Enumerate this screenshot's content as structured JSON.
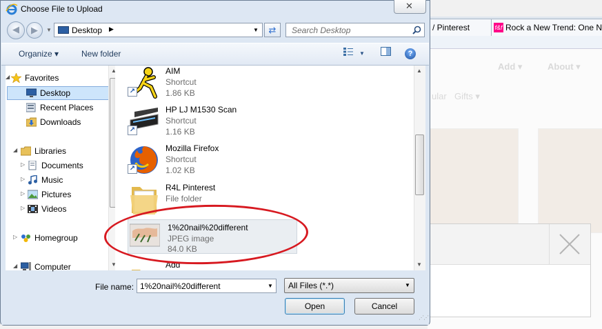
{
  "background_browser": {
    "tabs": [
      {
        "label": "/ Pinterest"
      },
      {
        "label": "Rock a New Trend: One N",
        "icon_text": "f&f"
      }
    ],
    "nav": [
      "Add ▾",
      "About ▾"
    ],
    "subnav": [
      "ular",
      "Gifts ▾"
    ]
  },
  "dialog": {
    "title": "Choose File to Upload",
    "address": {
      "location": "Desktop"
    },
    "search": {
      "placeholder": "Search Desktop"
    },
    "toolbar": {
      "organize_label": "Organize ▾",
      "new_folder_label": "New folder"
    },
    "nav_pane": {
      "favorites_label": "Favorites",
      "favorites": [
        {
          "label": "Desktop",
          "icon": "desktop-icon"
        },
        {
          "label": "Recent Places",
          "icon": "recent-places-icon"
        },
        {
          "label": "Downloads",
          "icon": "downloads-icon"
        }
      ],
      "libraries_label": "Libraries",
      "libraries": [
        {
          "label": "Documents",
          "icon": "documents-icon"
        },
        {
          "label": "Music",
          "icon": "music-icon"
        },
        {
          "label": "Pictures",
          "icon": "pictures-icon"
        },
        {
          "label": "Videos",
          "icon": "videos-icon"
        }
      ],
      "homegroup_label": "Homegroup",
      "computer_label": "Computer"
    },
    "files": [
      {
        "name": "AIM",
        "type": "Shortcut",
        "size": "1.86 KB",
        "icon": "aim-icon"
      },
      {
        "name": "HP LJ M1530 Scan",
        "type": "Shortcut",
        "size": "1.16 KB",
        "icon": "scanner-icon"
      },
      {
        "name": "Mozilla Firefox",
        "type": "Shortcut",
        "size": "1.02 KB",
        "icon": "firefox-icon"
      },
      {
        "name": "R4L Pinterest",
        "type": "File folder",
        "size": "",
        "icon": "folder-icon"
      },
      {
        "name": "1%20nail%20different",
        "type": "JPEG image",
        "size": "84.0 KB",
        "icon": "jpeg-thumbnail"
      },
      {
        "name": "Add",
        "type": "",
        "size": "",
        "icon": "folder-icon"
      }
    ],
    "file_name_label": "File name:",
    "file_name_value": "1%20nail%20different",
    "filter_value": "All Files (*.*)",
    "open_label": "Open",
    "cancel_label": "Cancel",
    "colors": {
      "highlight_ellipse": "#d71920",
      "selection": "#cde5fb"
    }
  }
}
